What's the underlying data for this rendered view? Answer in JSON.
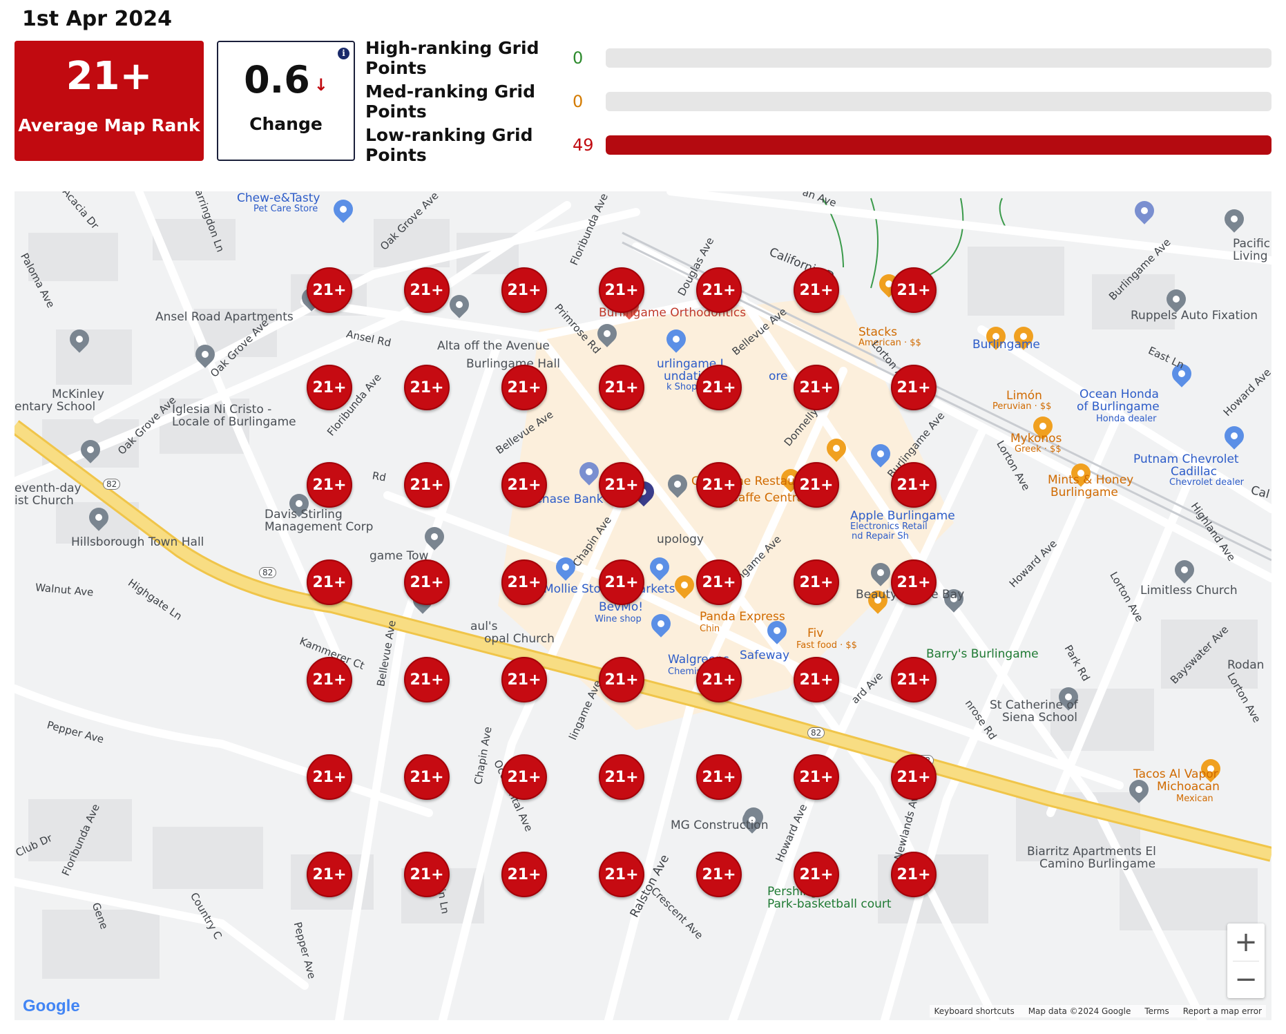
{
  "report": {
    "date": "1st Apr 2024"
  },
  "summary": {
    "avg_rank_value": "21+",
    "avg_rank_label": "Average Map Rank",
    "change_value": "0.6",
    "change_arrow": "↓",
    "change_label": "Change",
    "info_icon": "i"
  },
  "stats": [
    {
      "label": "High-ranking Grid Points",
      "value": "0",
      "color": "#2e8b2e",
      "fraction": 0
    },
    {
      "label": "Med-ranking Grid Points",
      "value": "0",
      "color": "#d47b00",
      "fraction": 0
    },
    {
      "label": "Low-ranking Grid Points",
      "value": "49",
      "color": "#c10a10",
      "fraction": 1
    }
  ],
  "grid": {
    "rows": 7,
    "cols": 7,
    "rank_label": "21+"
  },
  "map_labels": {
    "chew": "Chew-e&Tasty",
    "chew_sub": "Pet Care Store",
    "ansel_apts": "Ansel Road Apartments",
    "alta": "Alta off the Avenue",
    "burl_ortho": "Burlingame Orthodontics",
    "mckinley": "McKinley",
    "mckinley2": "entary School",
    "iglesia": "Iglesia Ni Cristo -",
    "iglesia2": "Locale of Burlingame",
    "seventh": "eventh-day",
    "seventh2": "ist Church",
    "davis": "Davis Stirling",
    "davis2": "Management Corp",
    "hills": "Hillsborough Town Hall",
    "chase": "Chase Bank",
    "mollie": "Mollie Stone's Markets",
    "bevmo": "BevMo!",
    "bevmo_sub": "Wine shop",
    "walgreens": "Walgreens",
    "walgreens_sub": "Chemist",
    "safeway": "Safeway",
    "stacks": "Stacks",
    "stacks_sub": "American · $$",
    "burlingame_station": "Burlingame",
    "limon": "Limón",
    "limon_sub": "Peruvian · $$",
    "ocean": "Ocean Honda",
    "ocean2": "of Burlingame",
    "ocean_sub": "Honda dealer",
    "mykonos": "Mykonos",
    "mykonos_sub": "Greek · $$",
    "putnam": "Putnam Chevrolet",
    "putnam2": "Cadillac",
    "putnam_sub": "Chevrolet dealer",
    "mints": "Mints & Honey",
    "mints2": "Burlingame",
    "crepevine": "Crepevine Restaurants",
    "caffe": "Caffe Central",
    "apple": "Apple Burlingame",
    "apple_sub": "Electronics Retail",
    "apple_sub2": "nd Repair Sh",
    "cupology": "upology",
    "beauty": "Beauty by the Bay",
    "barrys": "Barry's Burlingame",
    "limitless": "Limitless Church",
    "ruppels": "Ruppels Auto Fixation",
    "pacific": "Pacific",
    "pacific2": "Living",
    "stcath": "St Catherine of",
    "stcath2": "Siena School",
    "rodan": "Rodan",
    "tacos": "Tacos Al Vapor",
    "tacos2": "Michoacan",
    "tacos_sub": "Mexican",
    "mg": "MG Construction",
    "biarritz": "Biarritz Apartments El",
    "biarritz2": "Camino Burlingame",
    "pershing": "Pershing",
    "pershing2": "Park-basketball court",
    "panda": "Panda Express",
    "panda_sub": "Chin",
    "stpauls": "aul's",
    "stpauls2": "opal Church",
    "fast": "Fiv",
    "fast_sub": "Fast food · $$",
    "burl_hall": "Burlingame Hall",
    "burl_lib": "urlingame L",
    "burl_lib2": "undation",
    "burl_lib3": "ore",
    "burl_lib_sub": "k Shop",
    "burl_town": "game Tow"
  },
  "streets": {
    "acacia": "Acacia Dr",
    "farr": "Farringdon Ln",
    "oakgrove1": "Oak Grove Ave",
    "oakgrove2": "Oak Grove Ave",
    "oakgrove3": "Oak Grove Ave",
    "floribunda1": "Floribunda Ave",
    "floribunda2": "Floribunda Ave",
    "floribunda3": "Floribunda Ave",
    "douglas": "Douglas Ave",
    "california": "California D",
    "paloma": "Paloma Ave",
    "ansel": "Ansel Rd",
    "primrose": "Primrose Rd",
    "bellevue1": "Bellevue Ave",
    "bellevue2": "Bellevue Ave",
    "bellevue3": "Bellevue Ave",
    "lorton1": "Lorton Ave",
    "lorton2": "Lorton Ave",
    "lorton3": "Lorton Ave",
    "lorton4": "Lorton Ave",
    "donnelly": "Donnelly Ave",
    "burlave1": "Burlingame Ave",
    "burlave2": "Burlingame Ave",
    "burlave3": "Burlingame Ave",
    "burlave4": "lingame Ave",
    "eastln": "East Ln",
    "howard1": "Howard Ave",
    "howard2": "Howard Ave",
    "howard3": "Howard Ave",
    "howard4": "ard Ave",
    "highland": "Highland Ave",
    "chapin1": "Chapin Ave",
    "chapin2": "Chapin Ave",
    "chapin3": "Chapin Ln",
    "walnut": "Walnut Ave",
    "highgate": "Highgate Ln",
    "kammerer": "Kammerer Ct",
    "pepper1": "Pepper Ave",
    "pepper2": "Pepper Ave",
    "occidental": "Occidental Ave",
    "ralston": "Ralston Ave",
    "crescent": "Crescent Ave",
    "newlands": "Newlands Ave",
    "park": "Park Rd",
    "bayswater": "Bayswater Ave",
    "club": "Club Dr",
    "country": "Country C",
    "gene": "Gene",
    "rd": "Rd",
    "anave": "an Ave",
    "call": "Cal",
    "mrose": "nrose Rd"
  },
  "route_shields": [
    "82",
    "82",
    "82",
    "82",
    "82"
  ],
  "map_controls": {
    "zoom_in": "+",
    "zoom_out": "−"
  },
  "attribution": {
    "logo": "Google",
    "keyboard": "Keyboard shortcuts",
    "mapdata": "Map data ©2024 Google",
    "terms": "Terms",
    "report": "Report a map error"
  },
  "colors": {
    "accent": "#c10a10",
    "highway": "#f7d774",
    "park": "#c8e6c1",
    "commerce": "#fdf1e0"
  }
}
